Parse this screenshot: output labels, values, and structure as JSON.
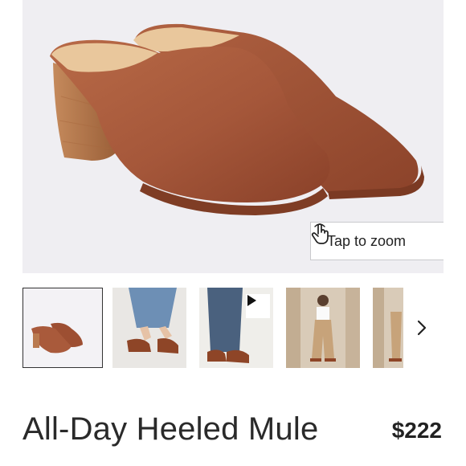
{
  "product": {
    "title": "All-Day Heeled Mule",
    "price": "$222"
  },
  "hero": {
    "zoom_label": "Tap to zoom",
    "zoom_icon": "tap-hand-icon"
  },
  "gallery": {
    "thumbnails": [
      {
        "name": "mule-pair-studio",
        "selected": true
      },
      {
        "name": "mule-on-feet-jeans"
      },
      {
        "name": "mule-video",
        "has_play": true
      },
      {
        "name": "model-full-body"
      },
      {
        "name": "model-partial"
      }
    ],
    "next_icon": "chevron-right-icon"
  },
  "colors": {
    "leather": "#a5573a",
    "leather_dark": "#7f3d25",
    "footbed": "#e9c79c",
    "heel": "#b97a4f",
    "hero_bg": "#efeef2"
  }
}
